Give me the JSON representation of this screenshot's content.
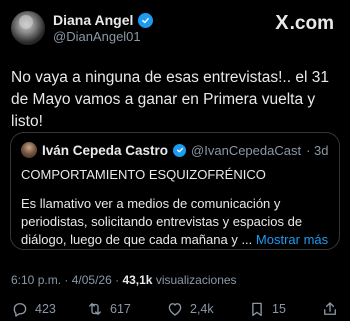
{
  "author": {
    "display_name": "Diana Angel",
    "handle": "@DianAngel01"
  },
  "brand": {
    "logo_text": ".com",
    "logo_x": "X"
  },
  "tweet": {
    "text": "No vaya a ninguna de esas entrevistas!.. el 31 de Mayo vamos a ganar en Primera vuelta y listo!"
  },
  "quoted": {
    "display_name": "Iván Cepeda Castro",
    "handle": "@IvanCepedaCast",
    "time": "· 3d",
    "line1": "COMPORTAMIENTO ESQUIZOFRÉNICO",
    "body": "Es llamativo ver a medios de comunicación y periodistas, solicitando entrevistas y espacios de diálogo, luego de que cada mañana y ...",
    "more_label": "Mostrar más"
  },
  "meta": {
    "time": "6:10 p.m.",
    "sep": "·",
    "date": "4/05/26",
    "views": "43,1k",
    "views_label": "visualizaciones"
  },
  "actions": {
    "replies": "423",
    "reposts": "617",
    "likes": "2,4k",
    "bookmarks": "15"
  },
  "colors": {
    "accent": "#1d9bf0",
    "background": "#000000",
    "muted": "#8b98a5"
  }
}
